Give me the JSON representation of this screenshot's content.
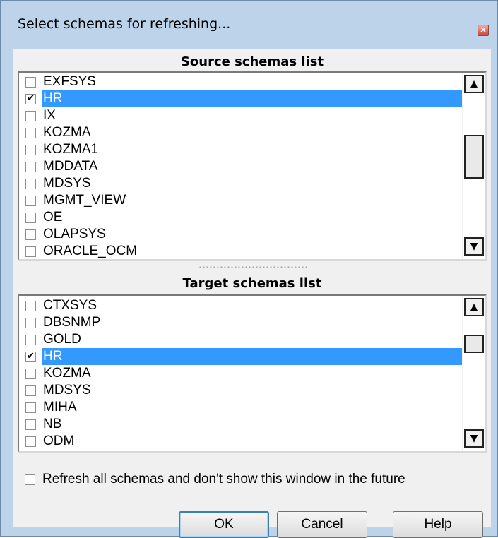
{
  "window": {
    "title": "Select schemas for refreshing...",
    "close_glyph": "×"
  },
  "source": {
    "header": "Source schemas list",
    "items": [
      {
        "label": "EXFSYS",
        "checked": false,
        "selected": false
      },
      {
        "label": "HR",
        "checked": true,
        "selected": true
      },
      {
        "label": "IX",
        "checked": false,
        "selected": false
      },
      {
        "label": "KOZMA",
        "checked": false,
        "selected": false
      },
      {
        "label": "KOZMA1",
        "checked": false,
        "selected": false
      },
      {
        "label": "MDDATA",
        "checked": false,
        "selected": false
      },
      {
        "label": "MDSYS",
        "checked": false,
        "selected": false
      },
      {
        "label": "MGMT_VIEW",
        "checked": false,
        "selected": false
      },
      {
        "label": "OE",
        "checked": false,
        "selected": false
      },
      {
        "label": "OLAPSYS",
        "checked": false,
        "selected": false
      },
      {
        "label": "ORACLE_OCM",
        "checked": false,
        "selected": false
      }
    ]
  },
  "target": {
    "header": "Target schemas list",
    "items": [
      {
        "label": "CTXSYS",
        "checked": false,
        "selected": false
      },
      {
        "label": "DBSNMP",
        "checked": false,
        "selected": false
      },
      {
        "label": "GOLD",
        "checked": false,
        "selected": false
      },
      {
        "label": "HR",
        "checked": true,
        "selected": true
      },
      {
        "label": "KOZMA",
        "checked": false,
        "selected": false
      },
      {
        "label": "MDSYS",
        "checked": false,
        "selected": false
      },
      {
        "label": "MIHA",
        "checked": false,
        "selected": false
      },
      {
        "label": "NB",
        "checked": false,
        "selected": false
      },
      {
        "label": "ODM",
        "checked": false,
        "selected": false
      }
    ]
  },
  "scroll": {
    "up_glyph": "▲",
    "down_glyph": "▼"
  },
  "footer": {
    "refresh_all_label": "Refresh all schemas and don't show this window in the future",
    "refresh_all_checked": false,
    "ok_label": "OK",
    "cancel_label": "Cancel",
    "help_label": "Help"
  },
  "icons": {
    "close": "close-icon",
    "scroll_up": "scroll-up-arrow-icon",
    "scroll_down": "scroll-down-arrow-icon",
    "grip": "splitter-grip-icon"
  },
  "colors": {
    "selection": "#3399ff",
    "frame": "#bcd3ea",
    "dialog_bg": "#f0f0f0",
    "default_button_border": "#3c7fb1"
  }
}
